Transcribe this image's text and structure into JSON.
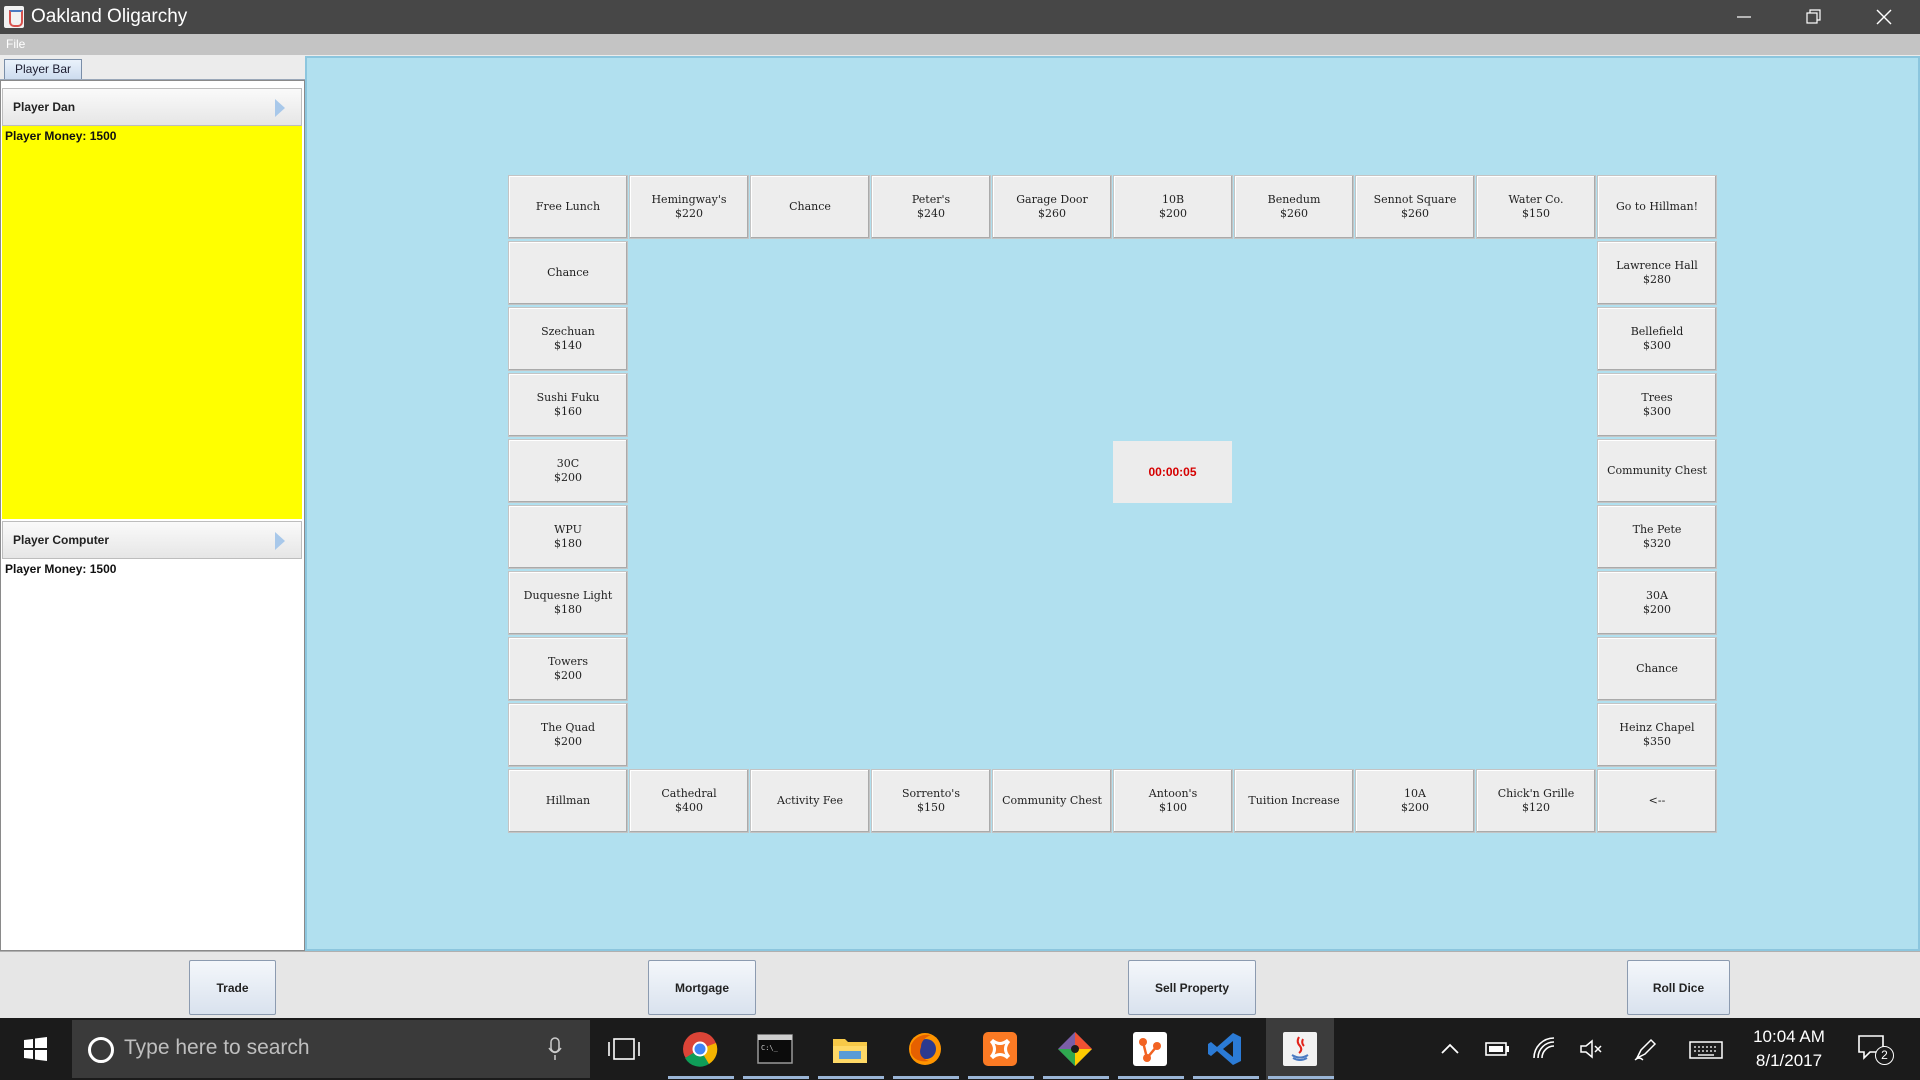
{
  "window": {
    "title": "Oakland Oligarchy"
  },
  "menu": {
    "file": "File"
  },
  "player_panel": {
    "tab_label": "Player Bar",
    "money_label": "Player Money:",
    "players": [
      {
        "name": "Player Dan",
        "money": "1500",
        "color": "#ffff00"
      },
      {
        "name": "Player Computer",
        "money": "1500",
        "color": "#ffffff"
      }
    ]
  },
  "board": {
    "top_row": [
      {
        "name": "Free Lunch",
        "price": ""
      },
      {
        "name": "Hemingway's",
        "price": "$220"
      },
      {
        "name": "Chance",
        "price": ""
      },
      {
        "name": "Peter's",
        "price": "$240"
      },
      {
        "name": "Garage Door",
        "price": "$260"
      },
      {
        "name": "10B",
        "price": "$200"
      },
      {
        "name": "Benedum",
        "price": "$260"
      },
      {
        "name": "Sennot Square",
        "price": "$260"
      },
      {
        "name": "Water Co.",
        "price": "$150"
      },
      {
        "name": "Go to Hillman!",
        "price": ""
      }
    ],
    "left_col": [
      {
        "name": "Chance",
        "price": ""
      },
      {
        "name": "Szechuan",
        "price": "$140"
      },
      {
        "name": "Sushi Fuku",
        "price": "$160"
      },
      {
        "name": "30C",
        "price": "$200"
      },
      {
        "name": "WPU",
        "price": "$180"
      },
      {
        "name": "Duquesne Light",
        "price": "$180"
      },
      {
        "name": "Towers",
        "price": "$200"
      },
      {
        "name": "The Quad",
        "price": "$200"
      }
    ],
    "right_col": [
      {
        "name": "Lawrence Hall",
        "price": "$280"
      },
      {
        "name": "Bellefield",
        "price": "$300"
      },
      {
        "name": "Trees",
        "price": "$300"
      },
      {
        "name": "Community Chest",
        "price": ""
      },
      {
        "name": "The Pete",
        "price": "$320"
      },
      {
        "name": "30A",
        "price": "$200"
      },
      {
        "name": "Chance",
        "price": ""
      },
      {
        "name": "Heinz Chapel",
        "price": "$350"
      }
    ],
    "bottom_row": [
      {
        "name": "Hillman",
        "price": ""
      },
      {
        "name": "Cathedral",
        "price": "$400"
      },
      {
        "name": "Activity Fee",
        "price": ""
      },
      {
        "name": "Sorrento's",
        "price": "$150"
      },
      {
        "name": "Community Chest",
        "price": ""
      },
      {
        "name": "Antoon's",
        "price": "$100"
      },
      {
        "name": "Tuition Increase",
        "price": ""
      },
      {
        "name": "10A",
        "price": "$200"
      },
      {
        "name": "Chick'n Grille",
        "price": "$120"
      },
      {
        "name": "<--",
        "price": ""
      }
    ],
    "timer": "00:00:05"
  },
  "actions": {
    "trade": "Trade",
    "mortgage": "Mortgage",
    "sell_property": "Sell Property",
    "roll_dice": "Roll Dice"
  },
  "taskbar": {
    "search_placeholder": "Type here to search",
    "time": "10:04 AM",
    "date": "8/1/2017",
    "notification_count": "2",
    "apps": [
      "task-view-icon",
      "chrome-icon",
      "terminal-icon",
      "file-explorer-icon",
      "firefox-icon",
      "xampp-icon",
      "git-icon",
      "sourcetree-icon",
      "vscode-icon",
      "java-icon"
    ]
  },
  "colors": {
    "board_background": "#b1e0ef",
    "timer_text": "#d50000"
  }
}
